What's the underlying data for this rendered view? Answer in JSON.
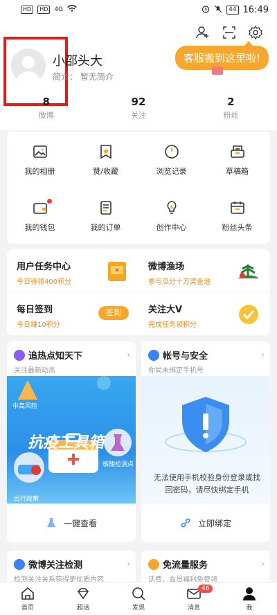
{
  "status_bar": {
    "time": "16:49",
    "battery": "44",
    "sim1": "HD",
    "sim2": "HD",
    "signal": "4G"
  },
  "header": {
    "username": "小邵头大",
    "bio_label": "简介：",
    "bio_value": "暂无简介",
    "bubble": "客服搬到这里啦!",
    "stats": [
      {
        "num": "8",
        "label": "微博"
      },
      {
        "num": "92",
        "label": "关注"
      },
      {
        "num": "2",
        "label": "粉丝"
      }
    ]
  },
  "grid": {
    "items": [
      {
        "label": "我的相册"
      },
      {
        "label": "赞/收藏"
      },
      {
        "label": "浏览记录"
      },
      {
        "label": "草稿箱"
      },
      {
        "label": "我的钱包"
      },
      {
        "label": "我的订单"
      },
      {
        "label": "创作中心"
      },
      {
        "label": "粉丝头条"
      }
    ]
  },
  "tasks": [
    {
      "title": "用户任务中心",
      "sub": "今日待领400积分"
    },
    {
      "title": "微博渔场",
      "sub": "参与瓜分十万奖金池"
    },
    {
      "title": "每日签到",
      "sub": "今日赚10积分",
      "button": "签到"
    },
    {
      "title": "关注大V",
      "sub": "完成任务领积分"
    }
  ],
  "feature_left": {
    "title": "追热点知天下",
    "sub": "关注最新动态",
    "banner_title": "抗疫工具箱",
    "chip1": "中高风险",
    "chip2": "核酸检测点",
    "chip3": "出行政策",
    "action": "一键查看"
  },
  "feature_right": {
    "title": "帐号与安全",
    "sub": "你尚未绑定手机号",
    "warning": "无法使用手机校验身份登录或找回密码，请尽快绑定手机",
    "action": "立即绑定"
  },
  "bottom_cards": [
    {
      "title": "微博关注检测",
      "sub": "检测关注关系获得更优质内容"
    },
    {
      "title": "免流量服务",
      "sub": "话费、会员福利免费领"
    }
  ],
  "nav": {
    "items": [
      {
        "label": "首页"
      },
      {
        "label": "超话"
      },
      {
        "label": "发现"
      },
      {
        "label": "消息",
        "badge": "46"
      },
      {
        "label": "我"
      }
    ]
  },
  "colors": {
    "accent": "#f7a72d",
    "blue": "#2c8fe8",
    "red": "#d8201c"
  }
}
